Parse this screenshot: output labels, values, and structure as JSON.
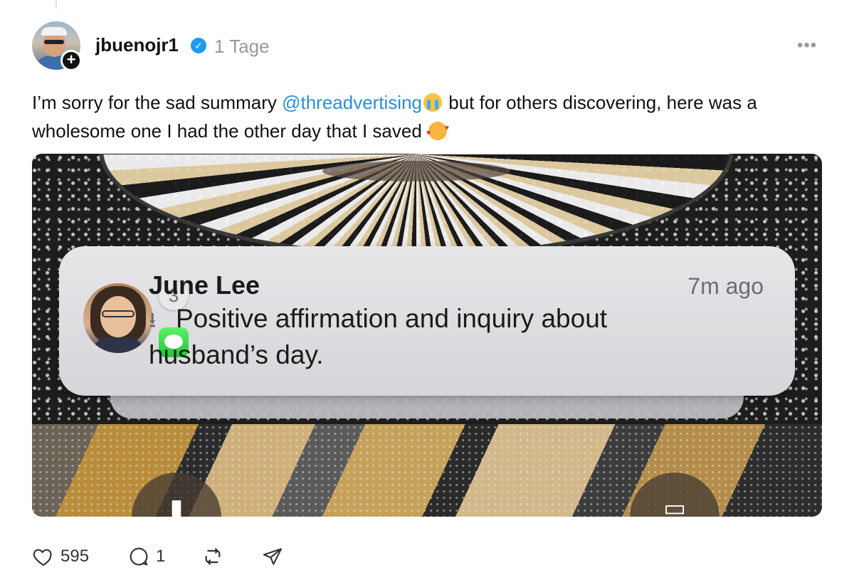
{
  "post": {
    "username": "jbuenojr1",
    "timestamp": "1 Tage",
    "text_before": "I’m sorry for the sad summary ",
    "mention": "@threadvertising",
    "text_after": " but for others discovering, here was a wholesome one I had the other day that I saved",
    "emoji_1": "loudly-crying-face",
    "emoji_2": "smiling-face-with-hearts"
  },
  "notification": {
    "sender": "June Lee",
    "time": "7m ago",
    "body": "Positive affirmation and inquiry about husband’s day.",
    "count": "3",
    "app": "Messages"
  },
  "actions": {
    "likes": "595",
    "comments": "1"
  },
  "colors": {
    "mention": "#2a8fd6",
    "verified": "#1d9bf0",
    "messages_green": "#20c63a"
  }
}
